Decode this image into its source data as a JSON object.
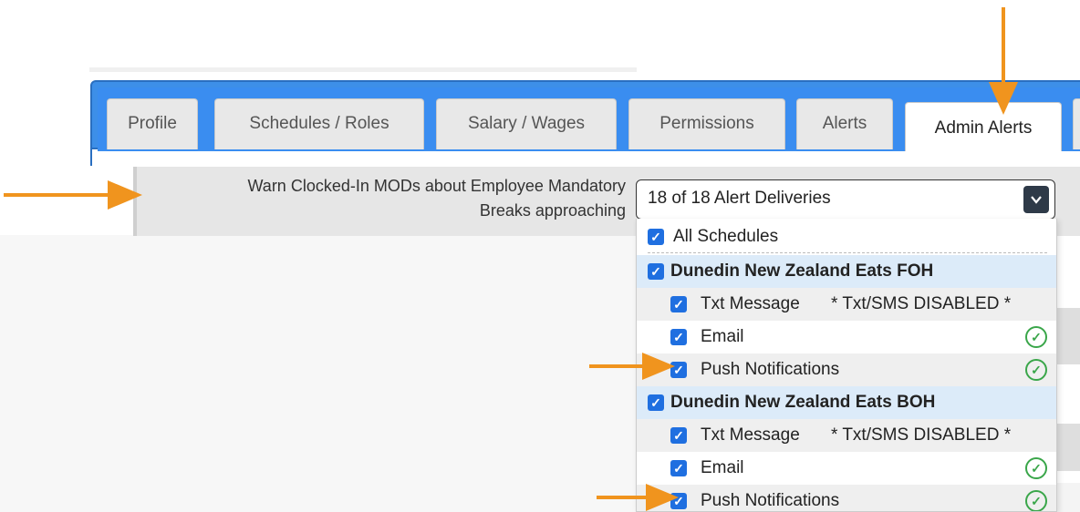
{
  "tabs": [
    {
      "label": "Profile",
      "active": false
    },
    {
      "label": "Schedules / Roles",
      "active": false
    },
    {
      "label": "Salary / Wages",
      "active": false
    },
    {
      "label": "Permissions",
      "active": false
    },
    {
      "label": "Alerts",
      "active": false
    },
    {
      "label": "Admin Alerts",
      "active": true
    }
  ],
  "setting": {
    "label_line1": "Warn Clocked-In MODs about Employee Mandatory",
    "label_line2": "Breaks approaching"
  },
  "select": {
    "value": "18 of 18 Alert Deliveries",
    "caret_icon": "chevron-down-icon"
  },
  "dropdown": {
    "all_label": "All Schedules",
    "groups": [
      {
        "name": "Dunedin New Zealand Eats FOH",
        "items": [
          {
            "label": "Txt Message",
            "note": "* Txt/SMS DISABLED *",
            "checked": true,
            "ok": false
          },
          {
            "label": "Email",
            "note": "",
            "checked": true,
            "ok": true
          },
          {
            "label": "Push Notifications",
            "note": "",
            "checked": true,
            "ok": true
          }
        ]
      },
      {
        "name": "Dunedin New Zealand Eats BOH",
        "items": [
          {
            "label": "Txt Message",
            "note": "* Txt/SMS DISABLED *",
            "checked": true,
            "ok": false
          },
          {
            "label": "Email",
            "note": "",
            "checked": true,
            "ok": true
          },
          {
            "label": "Push Notifications",
            "note": "",
            "checked": true,
            "ok": true
          }
        ]
      }
    ]
  },
  "colors": {
    "tabbar": "#3d8fe8",
    "checkbox": "#1f6fe0",
    "ok_green": "#3aa64a",
    "group_bg": "#dcebf9",
    "arrow": "#f0941e"
  }
}
